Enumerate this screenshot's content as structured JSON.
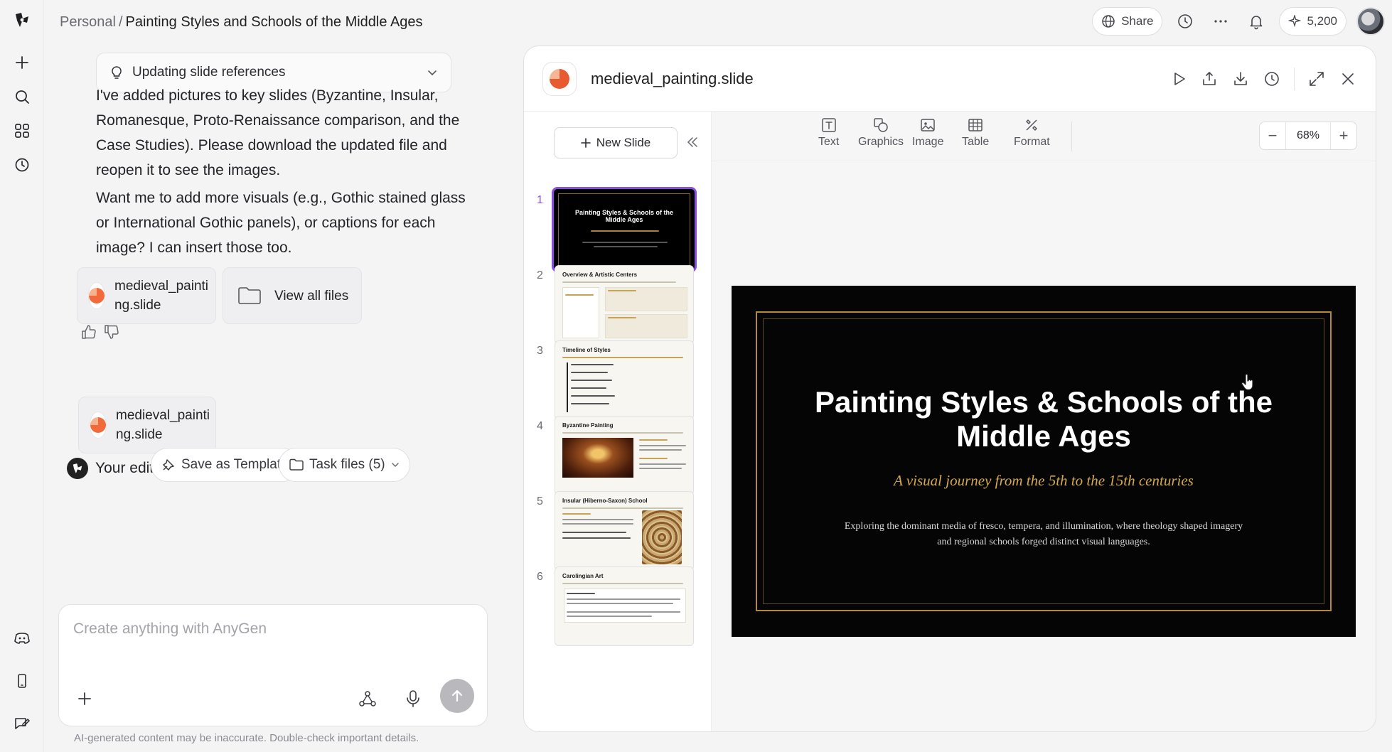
{
  "breadcrumb": {
    "root": "Personal",
    "separator": "/",
    "current": "Painting Styles and Schools of the Middle Ages"
  },
  "topbar": {
    "share_label": "Share",
    "credits": "5,200"
  },
  "chat": {
    "status_pill": "Updating slide references",
    "message_1": "I've added pictures to key slides (Byzantine, Insular, Romanesque, Proto-Renaissance comparison, and the Case Studies). Please download the updated file and reopen it to see the images.",
    "message_2": "Want me to add more visuals (e.g., Gothic stained glass or International Gothic panels), or captions for each image? I can insert those too.",
    "file_card_1": {
      "name_line1": "medieval_painti",
      "name_line2": "ng.slide"
    },
    "view_all_files": "View all files",
    "saved_message": "Your edits have been saved.",
    "file_card_2": {
      "name_line1": "medieval_painti",
      "name_line2": "ng.slide"
    },
    "save_template": "Save as Template",
    "task_files": "Task files (5)",
    "composer_placeholder": "Create anything with AnyGen",
    "disclaimer": "AI-generated content may be inaccurate. Double-check important details."
  },
  "editor": {
    "file_name": "medieval_painting.slide",
    "new_slide": "New Slide",
    "toolbar": {
      "text": "Text",
      "graphics": "Graphics",
      "image": "Image",
      "table": "Table",
      "format": "Format"
    },
    "zoom": "68%",
    "thumbnails": [
      {
        "num": "1",
        "title": "Painting Styles & Schools of the Middle Ages"
      },
      {
        "num": "2",
        "title": "Overview & Artistic Centers"
      },
      {
        "num": "3",
        "title": "Timeline of Styles"
      },
      {
        "num": "4",
        "title": "Byzantine Painting"
      },
      {
        "num": "5",
        "title": "Insular (Hiberno-Saxon) School"
      },
      {
        "num": "6",
        "title": "Carolingian Art"
      }
    ],
    "slide": {
      "title": "Painting Styles & Schools of the Middle Ages",
      "subtitle": "A visual journey from the 5th to the 15th centuries",
      "body": "Exploring the dominant media of fresco, tempera, and illumination, where theology shaped imagery and regional schools forged distinct visual languages."
    }
  },
  "colors": {
    "accent_purple": "#8b4fe0",
    "slide_gold": "#b48a3a",
    "slide_bg": "#050505",
    "brand_orange": "#f26a3b"
  }
}
